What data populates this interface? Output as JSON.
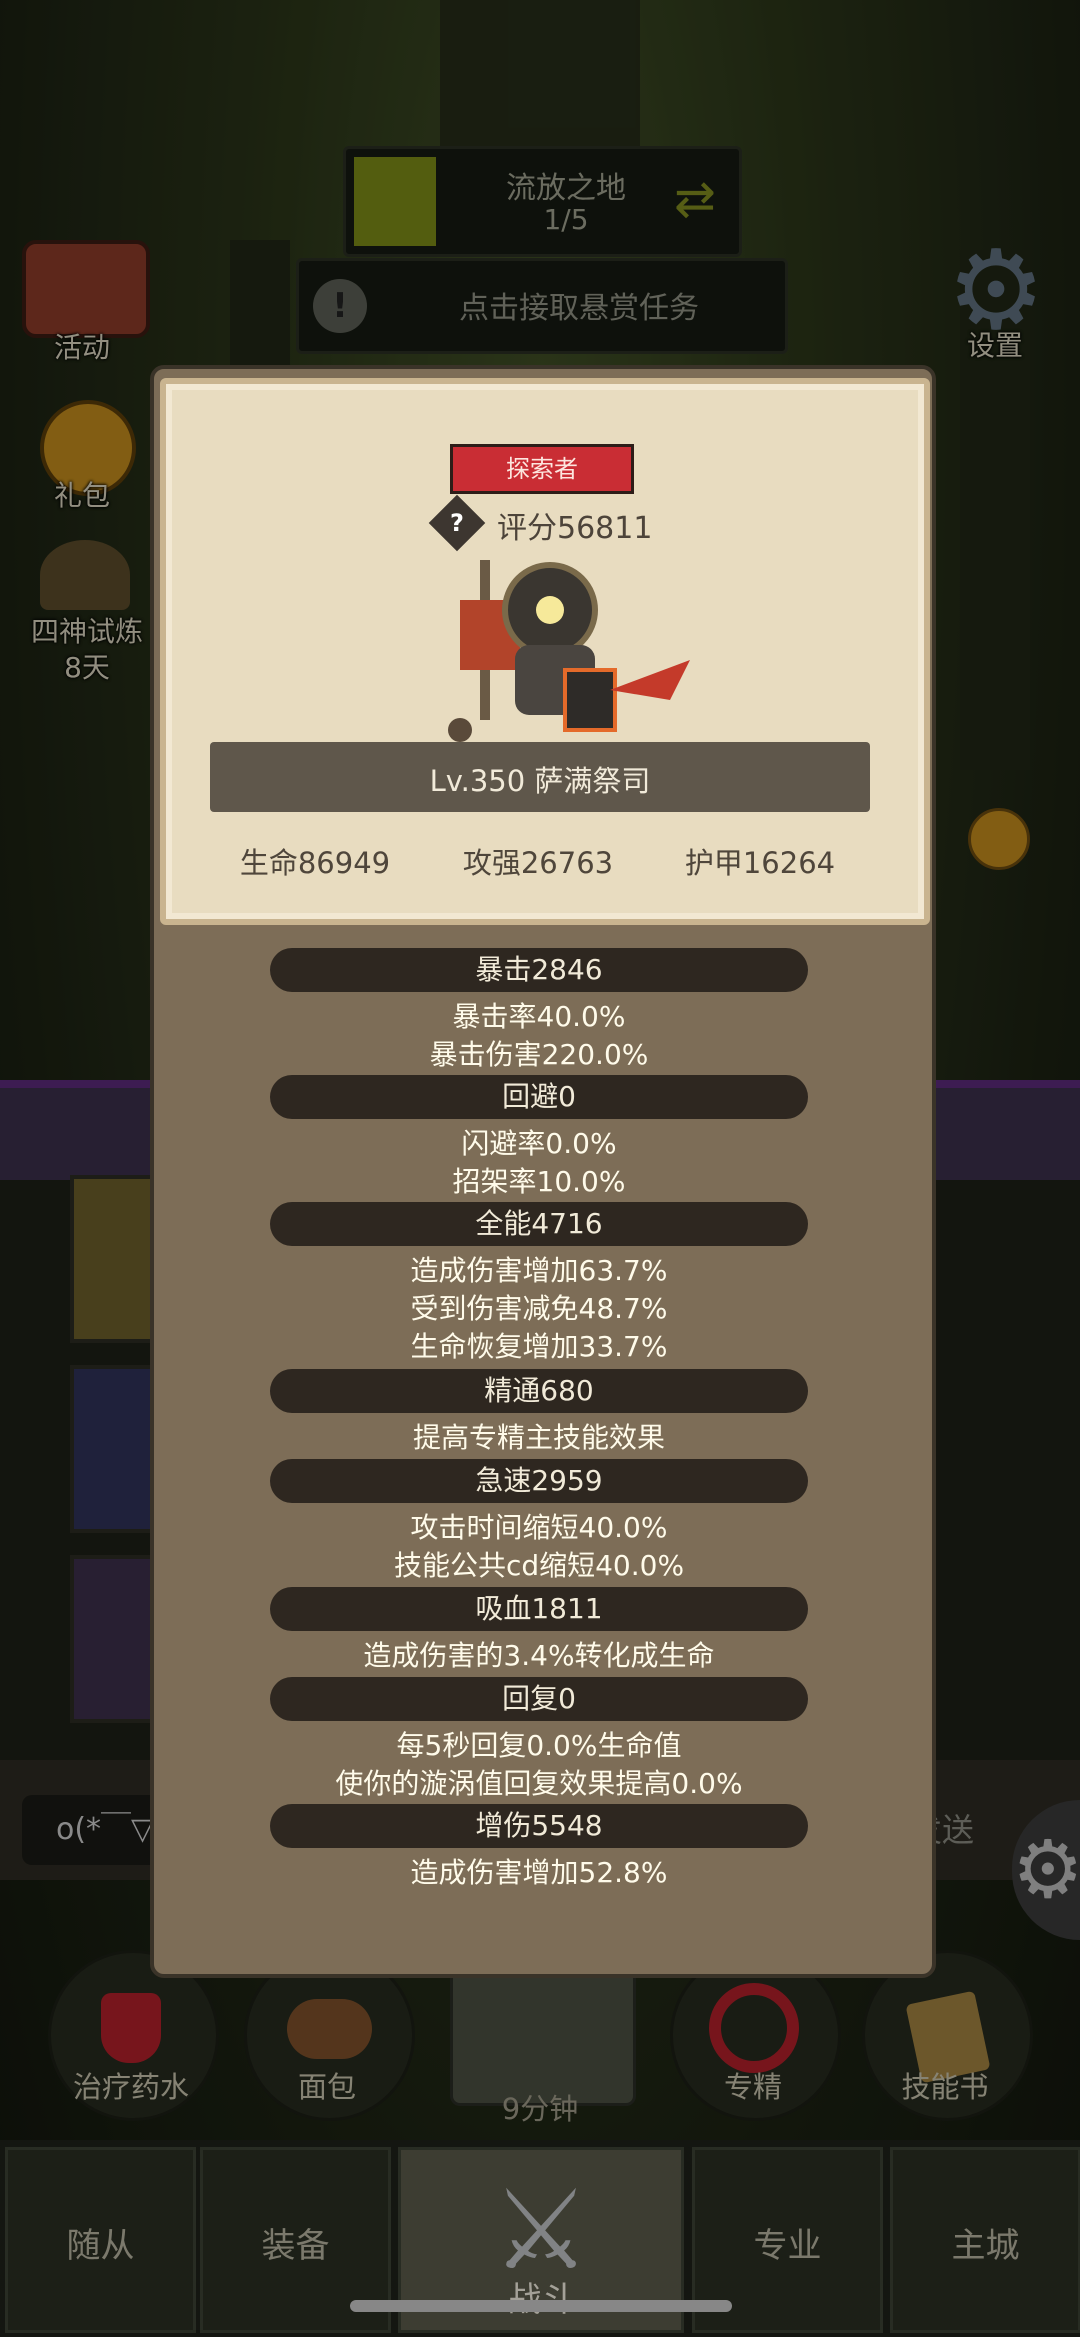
{
  "zone": {
    "name": "流放之地",
    "progress": "1/5"
  },
  "bounty": {
    "text": "点击接取悬赏任务"
  },
  "left_menu": {
    "event_label": "活动",
    "gift_label": "礼包",
    "trial_label": "四神试炼",
    "trial_days": "8天"
  },
  "right_menu": {
    "settings_label": "设置"
  },
  "hero": {
    "badge": "探索者",
    "rating": "评分56811",
    "name": "Lv.350 萨满祭司",
    "hp": "生命86949",
    "attack": "攻强26763",
    "armor": "护甲16264"
  },
  "stats": [
    {
      "title": "暴击2846",
      "lines": [
        "暴击率40.0%",
        "暴击伤害220.0%"
      ]
    },
    {
      "title": "回避0",
      "lines": [
        "闪避率0.0%",
        "招架率10.0%"
      ]
    },
    {
      "title": "全能4716",
      "lines": [
        "造成伤害增加63.7%",
        "受到伤害减免48.7%",
        "生命恢复增加33.7%"
      ]
    },
    {
      "title": "精通680",
      "lines": [
        "提高专精主技能效果"
      ]
    },
    {
      "title": "急速2959",
      "lines": [
        "攻击时间缩短40.0%",
        "技能公共cd缩短40.0%"
      ]
    },
    {
      "title": "吸血1811",
      "lines": [
        "造成伤害的3.4%转化成生命"
      ]
    },
    {
      "title": "回复0",
      "lines": [
        "每5秒回复0.0%生命值",
        "使你的漩涡值回复效果提高0.0%"
      ]
    },
    {
      "title": "增伤5548",
      "lines": [
        "造成伤害增加52.8%"
      ]
    }
  ],
  "chat": {
    "input_text": "o(*￣▽",
    "send_label": "发送"
  },
  "actions": {
    "potion": "治疗药水",
    "bread": "面包",
    "chest_timer": "9分钟",
    "spec": "专精",
    "skillbook": "技能书"
  },
  "tabs": {
    "followers": "随从",
    "equipment": "装备",
    "battle": "战斗",
    "profession": "专业",
    "city": "主城"
  },
  "colors": {
    "badge_red": "#c92d34",
    "parchment": "#e8dcc0",
    "panel_brown": "#7d6d57"
  }
}
